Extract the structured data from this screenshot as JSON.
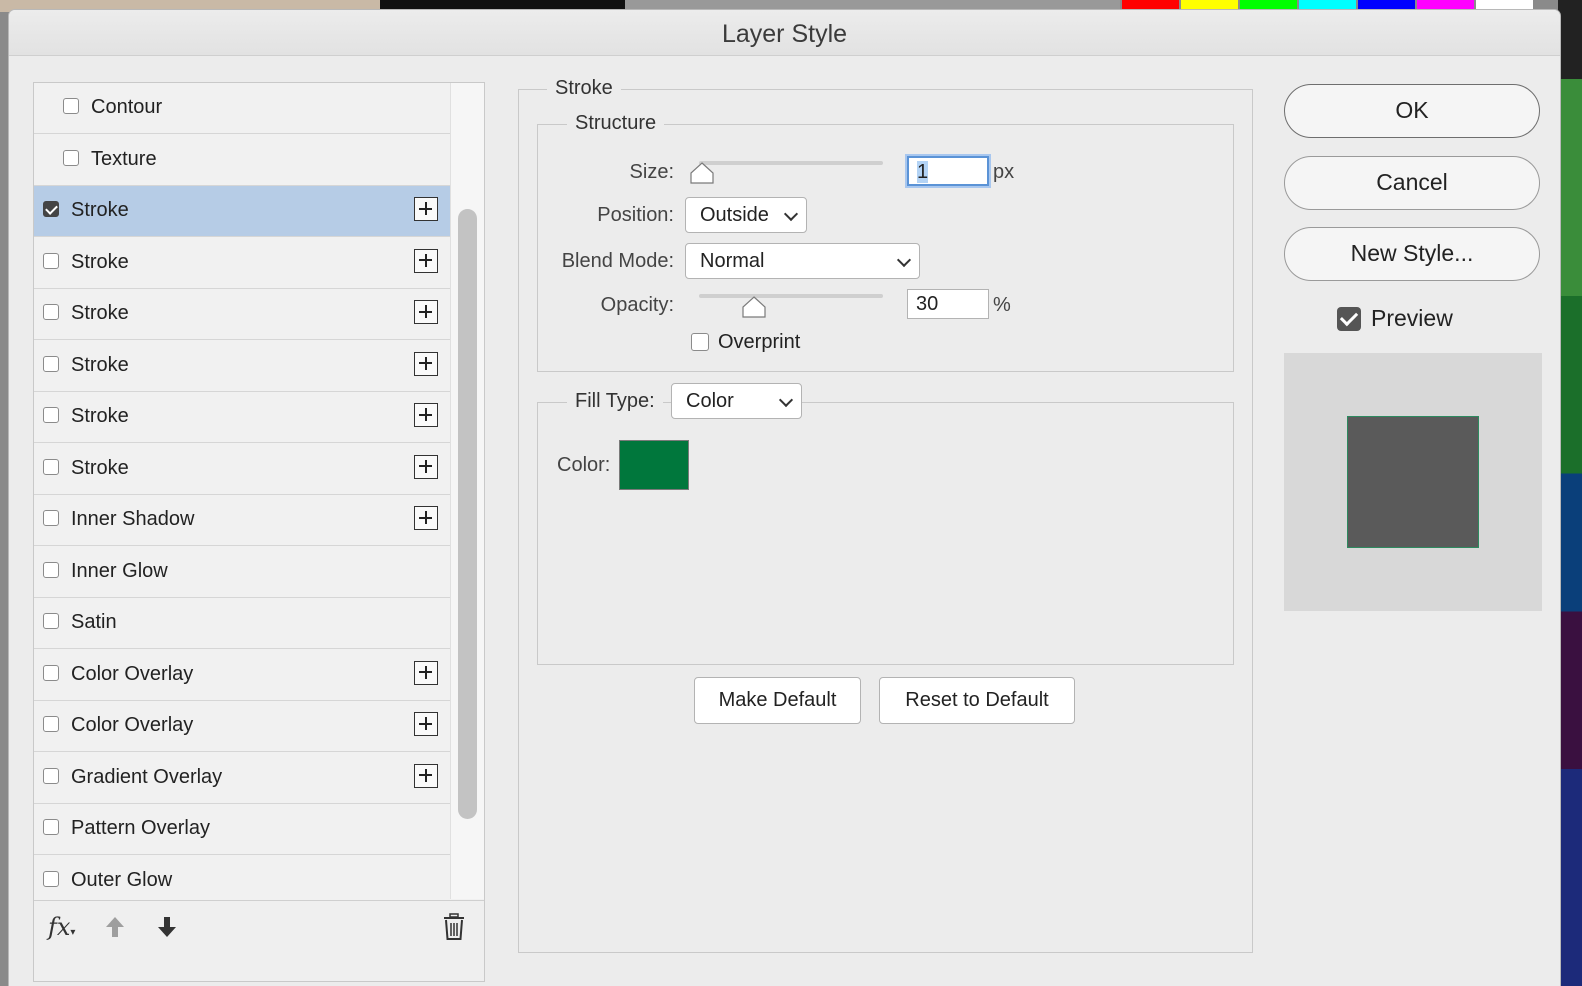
{
  "dialog": {
    "title": "Layer Style"
  },
  "style_list": [
    {
      "label": "Contour",
      "checked": false,
      "selected": false,
      "has_plus": false,
      "indent": true
    },
    {
      "label": "Texture",
      "checked": false,
      "selected": false,
      "has_plus": false,
      "indent": true
    },
    {
      "label": "Stroke",
      "checked": true,
      "selected": true,
      "has_plus": true,
      "indent": false
    },
    {
      "label": "Stroke",
      "checked": false,
      "selected": false,
      "has_plus": true,
      "indent": false
    },
    {
      "label": "Stroke",
      "checked": false,
      "selected": false,
      "has_plus": true,
      "indent": false
    },
    {
      "label": "Stroke",
      "checked": false,
      "selected": false,
      "has_plus": true,
      "indent": false
    },
    {
      "label": "Stroke",
      "checked": false,
      "selected": false,
      "has_plus": true,
      "indent": false
    },
    {
      "label": "Stroke",
      "checked": false,
      "selected": false,
      "has_plus": true,
      "indent": false
    },
    {
      "label": "Inner Shadow",
      "checked": false,
      "selected": false,
      "has_plus": true,
      "indent": false
    },
    {
      "label": "Inner Glow",
      "checked": false,
      "selected": false,
      "has_plus": false,
      "indent": false
    },
    {
      "label": "Satin",
      "checked": false,
      "selected": false,
      "has_plus": false,
      "indent": false
    },
    {
      "label": "Color Overlay",
      "checked": false,
      "selected": false,
      "has_plus": true,
      "indent": false
    },
    {
      "label": "Color Overlay",
      "checked": false,
      "selected": false,
      "has_plus": true,
      "indent": false
    },
    {
      "label": "Gradient Overlay",
      "checked": false,
      "selected": false,
      "has_plus": true,
      "indent": false
    },
    {
      "label": "Pattern Overlay",
      "checked": false,
      "selected": false,
      "has_plus": false,
      "indent": false
    },
    {
      "label": "Outer Glow",
      "checked": false,
      "selected": false,
      "has_plus": false,
      "indent": false
    }
  ],
  "list_footer": {
    "fx_label": "fx",
    "move_up_icon": "arrow-up-icon",
    "move_down_icon": "arrow-down-icon",
    "delete_icon": "trash-icon"
  },
  "stroke": {
    "title": "Stroke",
    "structure_title": "Structure",
    "size_label": "Size:",
    "size_value": "1",
    "size_unit": "px",
    "size_slider_level": 0,
    "position_label": "Position:",
    "position_value": "Outside",
    "blend_mode_label": "Blend Mode:",
    "blend_mode_value": "Normal",
    "opacity_label": "Opacity:",
    "opacity_value": "30",
    "opacity_unit": "%",
    "opacity_slider_level": 0.3,
    "overprint_label": "Overprint",
    "overprint_checked": false,
    "fill_type_label": "Fill Type:",
    "fill_type_value": "Color",
    "color_label": "Color:",
    "color_value": "#00773c"
  },
  "actions": {
    "make_default": "Make Default",
    "reset_to_default": "Reset to Default",
    "ok": "OK",
    "cancel": "Cancel",
    "new_style": "New Style...",
    "preview_label": "Preview",
    "preview_checked": true
  },
  "colors": {
    "selection": "#b6cce6",
    "preview_swatch": "#5a5a5a",
    "palette": [
      "#ff0000",
      "#ffff00",
      "#00ff00",
      "#00ffff",
      "#0000ff",
      "#ff00ff",
      "#ffffff"
    ]
  }
}
